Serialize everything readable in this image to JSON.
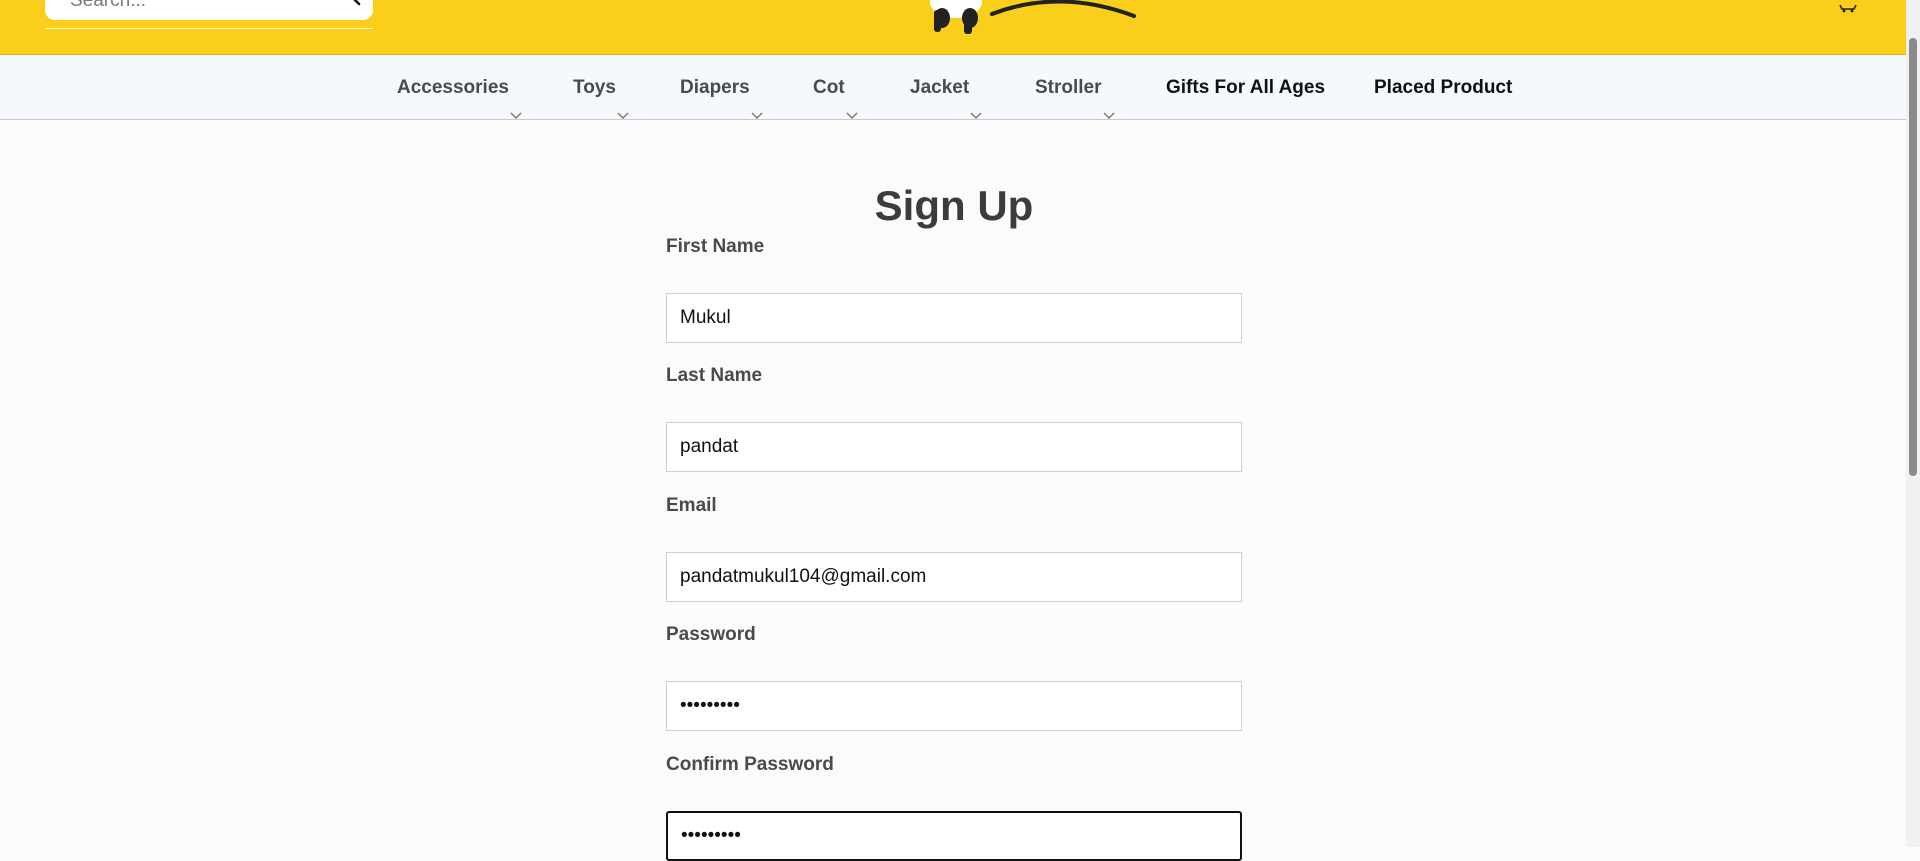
{
  "header": {
    "search_placeholder": "Search...",
    "search_icon": "search-icon",
    "logo_icon": "panda-logo",
    "cart_icon": "cart-icon",
    "bg_color": "#f9cf1b"
  },
  "nav": {
    "items": [
      {
        "label": "Accessories",
        "has_dropdown": true
      },
      {
        "label": "Toys",
        "has_dropdown": true
      },
      {
        "label": "Diapers",
        "has_dropdown": true
      },
      {
        "label": "Cot",
        "has_dropdown": true
      },
      {
        "label": "Jacket",
        "has_dropdown": true
      },
      {
        "label": "Stroller",
        "has_dropdown": true
      },
      {
        "label": "Gifts For All Ages",
        "has_dropdown": false
      },
      {
        "label": "Placed Product",
        "has_dropdown": false
      }
    ]
  },
  "form": {
    "title": "Sign Up",
    "fields": [
      {
        "label": "First Name",
        "value": "Mukul",
        "type": "text"
      },
      {
        "label": "Last Name",
        "value": "pandat",
        "type": "text"
      },
      {
        "label": "Email",
        "value": "pandatmukul104@gmail.com",
        "type": "email"
      },
      {
        "label": "Password",
        "value": "•••••••••",
        "type": "password"
      },
      {
        "label": "Confirm Password",
        "value": "•••••••••",
        "type": "password",
        "focused": true
      }
    ]
  }
}
